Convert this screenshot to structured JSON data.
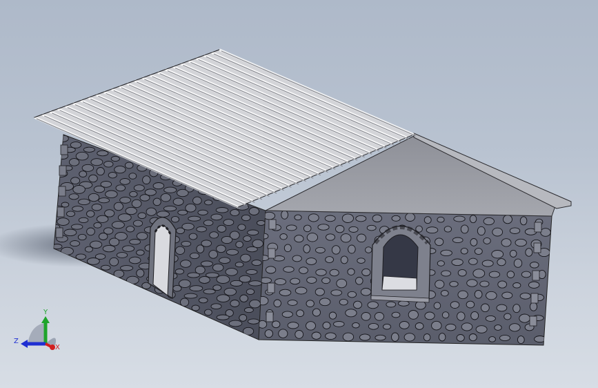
{
  "viewport": {
    "background_top": "#aeb9c9",
    "background_bottom": "#d7dde5"
  },
  "model": {
    "name": "stone-barn",
    "roof": "corrugated-sheet",
    "walls": "rubble-stone",
    "openings": [
      "arched-doorway",
      "arched-window"
    ]
  },
  "triad": {
    "x_label": "X",
    "y_label": "Y",
    "z_label": "Z",
    "x_color": "#d21f1f",
    "y_color": "#1fa42b",
    "z_color": "#1f2fd2"
  }
}
